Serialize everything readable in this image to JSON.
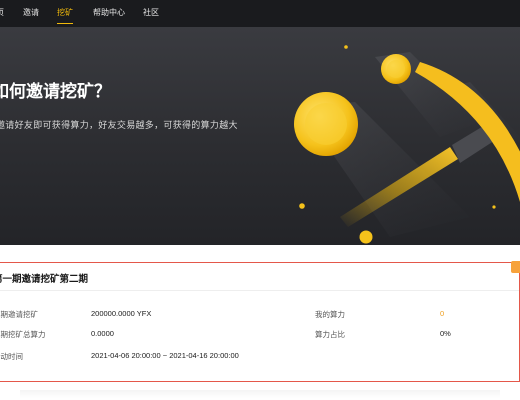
{
  "nav": {
    "items": [
      {
        "label": "首页"
      },
      {
        "label": "邀请"
      },
      {
        "label": "挖矿"
      },
      {
        "label": "帮助中心"
      },
      {
        "label": "社区"
      }
    ],
    "active_index": 2,
    "accent_color": "#f0b90b"
  },
  "hero": {
    "title": "如何邀请挖矿？",
    "subtitle": "邀请好友即可获得算力，好友交易越多，可获得的算力越大",
    "art": [
      "coin-icon",
      "pickaxe-icon"
    ]
  },
  "card": {
    "title": "第一期邀请挖矿第二期",
    "border_color": "#e4574a",
    "rows": [
      {
        "label": "本期邀请挖矿",
        "value": "200000.0000 YFX"
      },
      {
        "label": "本期挖矿总算力",
        "value": "0.0000"
      },
      {
        "label": "活动时间",
        "value": "2021-04-06 20:00:00 ~ 2021-04-16 20:00:00"
      }
    ],
    "stats": [
      {
        "label": "我的算力",
        "value": "0",
        "color": "#f0a020"
      },
      {
        "label": "算力占比",
        "value": "0%"
      }
    ]
  }
}
